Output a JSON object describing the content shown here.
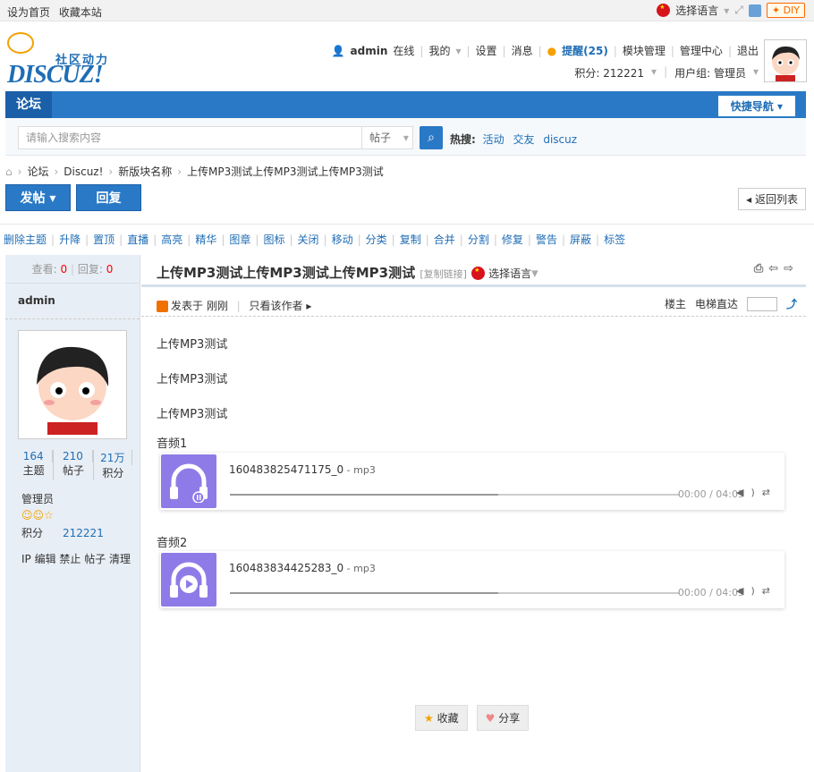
{
  "topbar": {
    "set_home": "设为首页",
    "bookmark": "收藏本站",
    "language": "选择语言",
    "diy": "DIY"
  },
  "logo": {
    "slogan": "社区动力",
    "wordmark": "DISCUZ!"
  },
  "user": {
    "name": "admin",
    "online": "在线",
    "my": "我的",
    "settings": "设置",
    "messages": "消息",
    "remind": "提醒(25)",
    "module_manage": "模块管理",
    "admin_center": "管理中心",
    "logout": "退出",
    "points": "积分: 212221",
    "group": "用户组: 管理员"
  },
  "nav": {
    "forum_tab": "论坛",
    "quick_nav": "快捷导航 ▾"
  },
  "search": {
    "placeholder": "请输入搜索内容",
    "type": "帖子",
    "hot_label": "热搜:",
    "hot": [
      "活动",
      "交友",
      "discuz"
    ]
  },
  "breadcrumb": [
    "论坛",
    "Discuz!",
    "新版块名称",
    "上传MP3测试上传MP3测试上传MP3测试"
  ],
  "buttons": {
    "post": "发帖 ▾",
    "reply": "回复",
    "back": "◂ 返回列表"
  },
  "mod": [
    "删除主题",
    "升降",
    "置顶",
    "直播",
    "高亮",
    "精华",
    "图章",
    "图标",
    "关闭",
    "移动",
    "分类",
    "复制",
    "合并",
    "分割",
    "修复",
    "警告",
    "屏蔽",
    "标签"
  ],
  "side": {
    "views_label": "查看:",
    "views": "0",
    "replies_label": "回复:",
    "replies": "0",
    "author": "admin",
    "stats": [
      {
        "n": "164",
        "l": "主题"
      },
      {
        "n": "210",
        "l": "帖子"
      },
      {
        "n": "21万",
        "l": "积分"
      }
    ],
    "group": "管理员",
    "points_label": "积分",
    "points": "212221",
    "ops": "IP 编辑 禁止 帖子 清理"
  },
  "post": {
    "title": "上传MP3测试上传MP3测试上传MP3测试",
    "copy_link": "[复制链接]",
    "language": "选择语言",
    "posted": "发表于 刚刚",
    "only_author": "只看该作者 ▸",
    "floor": "楼主",
    "elevator": "电梯直达",
    "lines": [
      "上传MP3测试",
      "上传MP3测试",
      "上传MP3测试"
    ]
  },
  "audio": [
    {
      "label": "音频1",
      "name": "160483825471175_0",
      "ext": " - mp3",
      "time": "00:00 / 04:05",
      "progress": 0.0
    },
    {
      "label": "音频2",
      "name": "160483834425283_0",
      "ext": " - mp3",
      "time": "00:00 / 04:05",
      "progress": 0.0
    }
  ],
  "actions": {
    "fav": "收藏",
    "share": "分享"
  },
  "colors": {
    "accent": "#2a79c6",
    "cover": "#8f7be7"
  }
}
